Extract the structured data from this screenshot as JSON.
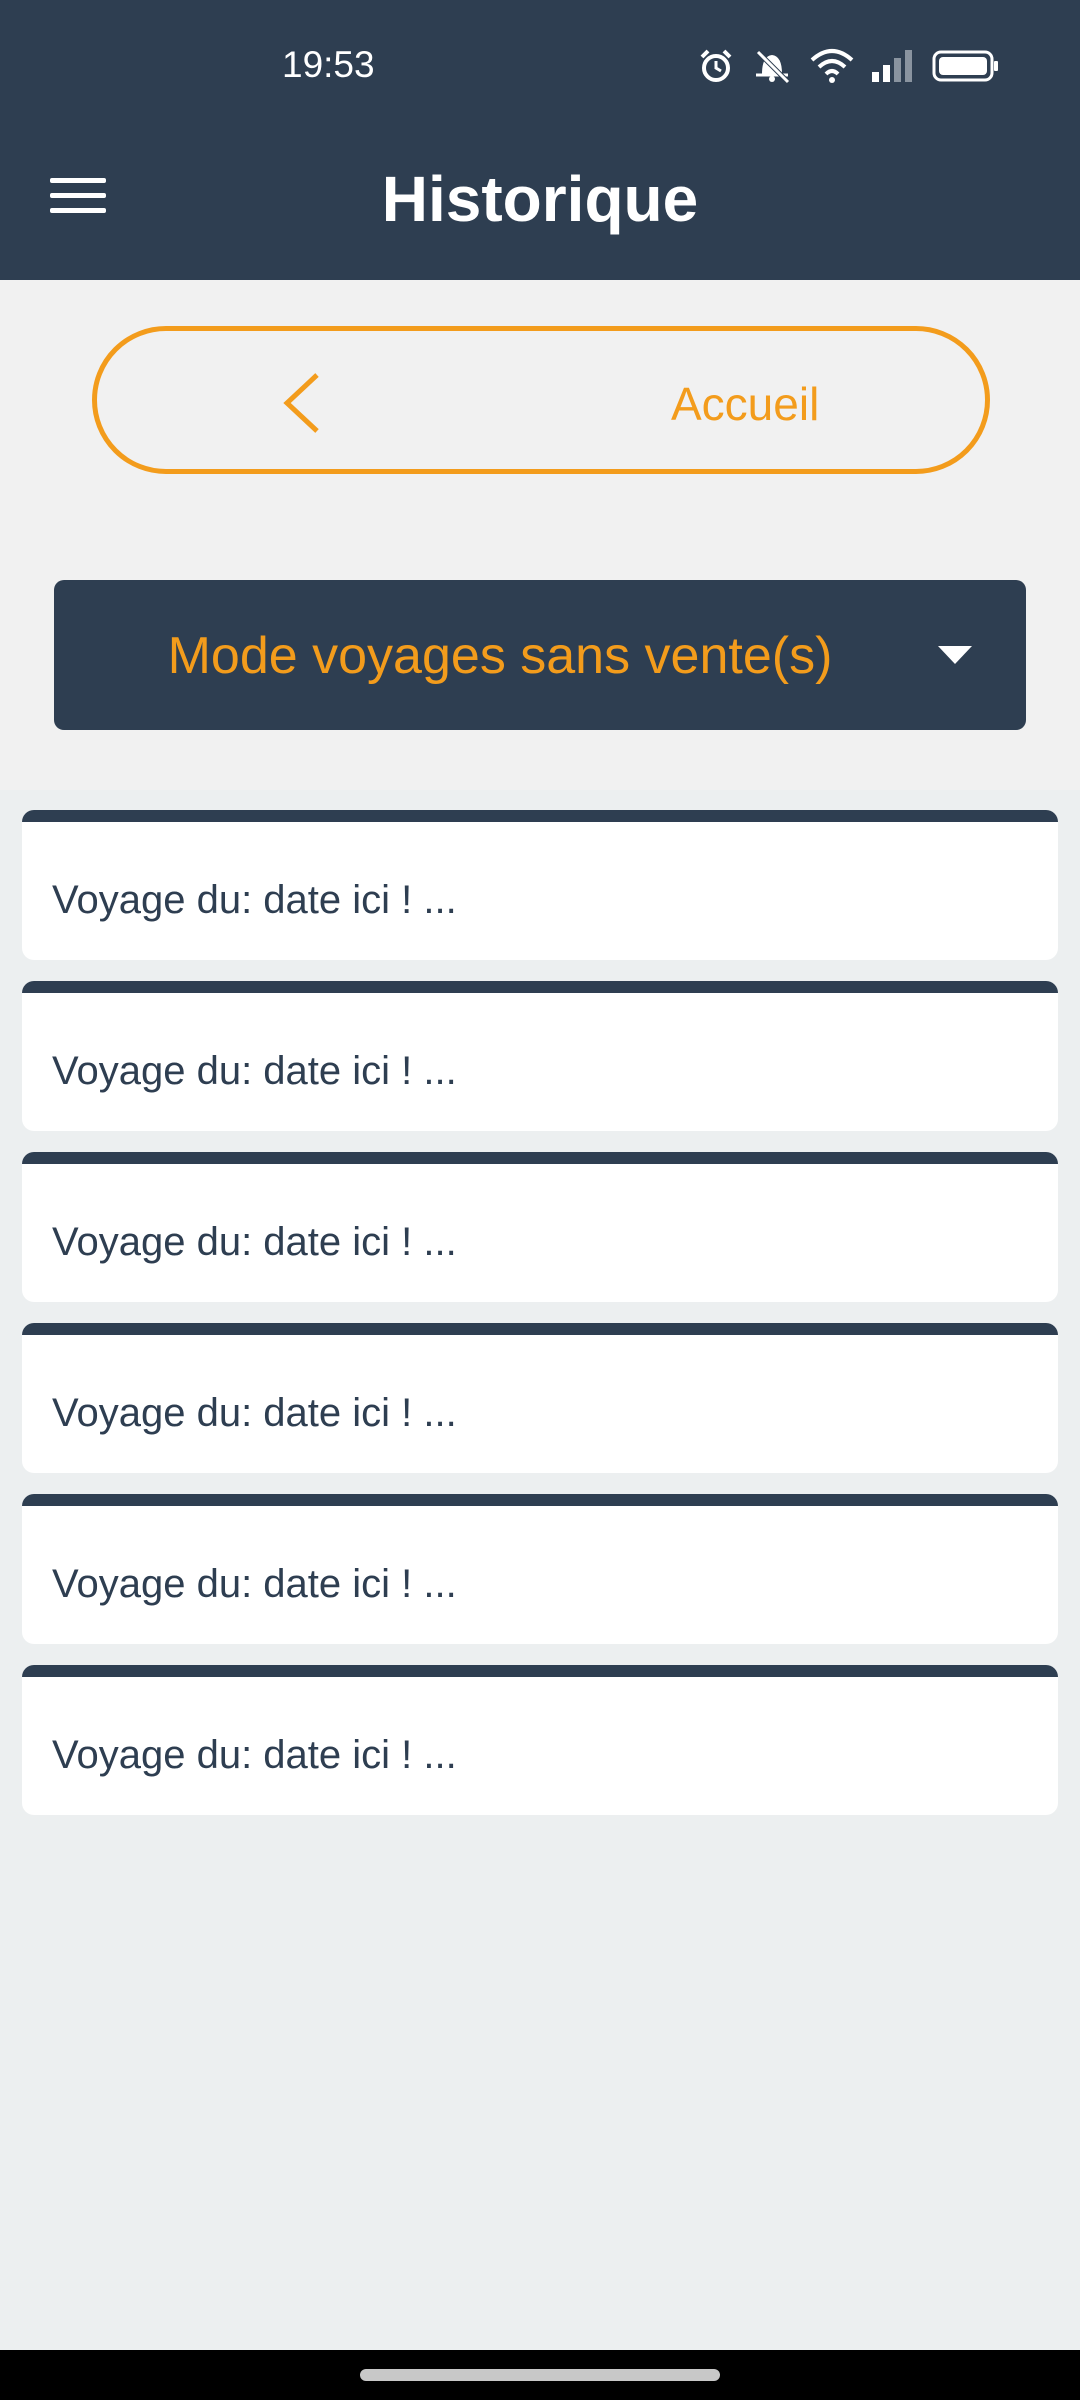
{
  "status_bar": {
    "time": "19:53",
    "icons": [
      "alarm-icon",
      "bell-off-icon",
      "wifi-icon",
      "signal-icon",
      "battery-icon"
    ]
  },
  "header": {
    "menu_icon": "hamburger-menu-icon",
    "title": "Historique"
  },
  "back_button": {
    "icon": "chevron-left-icon",
    "label": "Accueil"
  },
  "mode_selector": {
    "selected": "Mode voyages sans vente(s)",
    "icon": "caret-down-icon"
  },
  "trips": [
    {
      "label": "Voyage du: date ici ! ..."
    },
    {
      "label": "Voyage du: date ici ! ..."
    },
    {
      "label": "Voyage du: date ici ! ..."
    },
    {
      "label": "Voyage du: date ici ! ..."
    },
    {
      "label": "Voyage du: date ici ! ..."
    },
    {
      "label": "Voyage du: date ici ! ..."
    }
  ],
  "colors": {
    "header_bg": "#2e3e51",
    "accent": "#f39c1c",
    "page_bg": "#eceff0",
    "panel_bg": "#f1f1f1",
    "card_bg": "#ffffff"
  }
}
